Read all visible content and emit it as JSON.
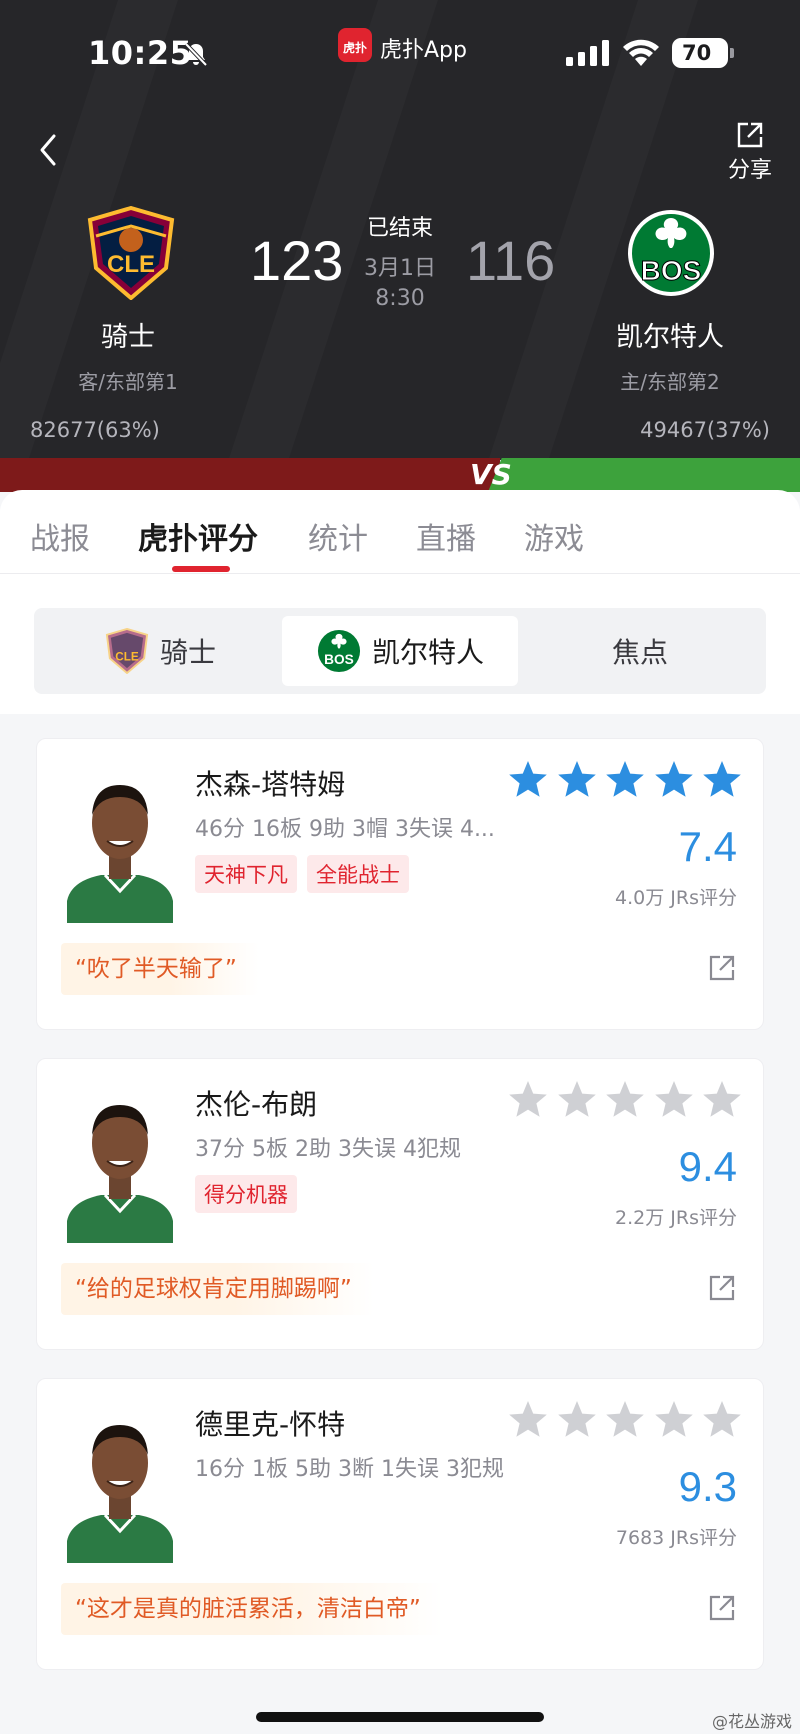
{
  "status_bar": {
    "time": "10:25",
    "app_name": "虎扑App",
    "app_badge": "虎扑",
    "battery": "70"
  },
  "header": {
    "share_label": "分享",
    "home_team": {
      "logo_text": "CLE",
      "name": "骑士",
      "sub": "客/东部第1",
      "score": "123",
      "votes": "82677(63%)",
      "color": "#7e1a1a"
    },
    "away_team": {
      "logo_text": "BOS",
      "name": "凯尔特人",
      "sub": "主/东部第2",
      "score": "116",
      "votes": "49467(37%)",
      "color": "#3da23c"
    },
    "game_status": "已结束",
    "game_date": "3月1日",
    "game_time": "8:30",
    "vs_text": "VS"
  },
  "tabs": [
    {
      "label": "战报",
      "active": false
    },
    {
      "label": "虎扑评分",
      "active": true
    },
    {
      "label": "统计",
      "active": false
    },
    {
      "label": "直播",
      "active": false
    },
    {
      "label": "游戏",
      "active": false
    }
  ],
  "team_switch": [
    {
      "label": "骑士",
      "icon": "cavaliers-logo-icon",
      "active": false
    },
    {
      "label": "凯尔特人",
      "icon": "celtics-logo-icon",
      "active": true
    },
    {
      "label": "焦点",
      "icon": "",
      "active": false
    }
  ],
  "players": [
    {
      "name": "杰森-塔特姆",
      "stats": "46分 16板 9助 3帽 3失误 4...",
      "tags": [
        "天神下凡",
        "全能战士"
      ],
      "stars_filled": 5,
      "rating": "7.4",
      "rating_count": "4.0万 JRs评分",
      "quote": "“吹了半天输了”"
    },
    {
      "name": "杰伦-布朗",
      "stats": "37分 5板 2助 3失误 4犯规",
      "tags": [
        "得分机器"
      ],
      "stars_filled": 0,
      "rating": "9.4",
      "rating_count": "2.2万 JRs评分",
      "quote": "“给的足球权肯定用脚踢啊”"
    },
    {
      "name": "德里克-怀特",
      "stats": "16分 1板 5助 3断 1失误 3犯规",
      "tags": [],
      "stars_filled": 0,
      "rating": "9.3",
      "rating_count": "7683 JRs评分",
      "quote": "“这才是真的脏活累活，清洁白帝”"
    }
  ],
  "colors": {
    "accent_red": "#e0242f",
    "rating_blue": "#2c8ee0",
    "star_filled": "#2c8ee0",
    "star_empty": "#cfd0d4"
  },
  "watermark": "@花丛游戏"
}
